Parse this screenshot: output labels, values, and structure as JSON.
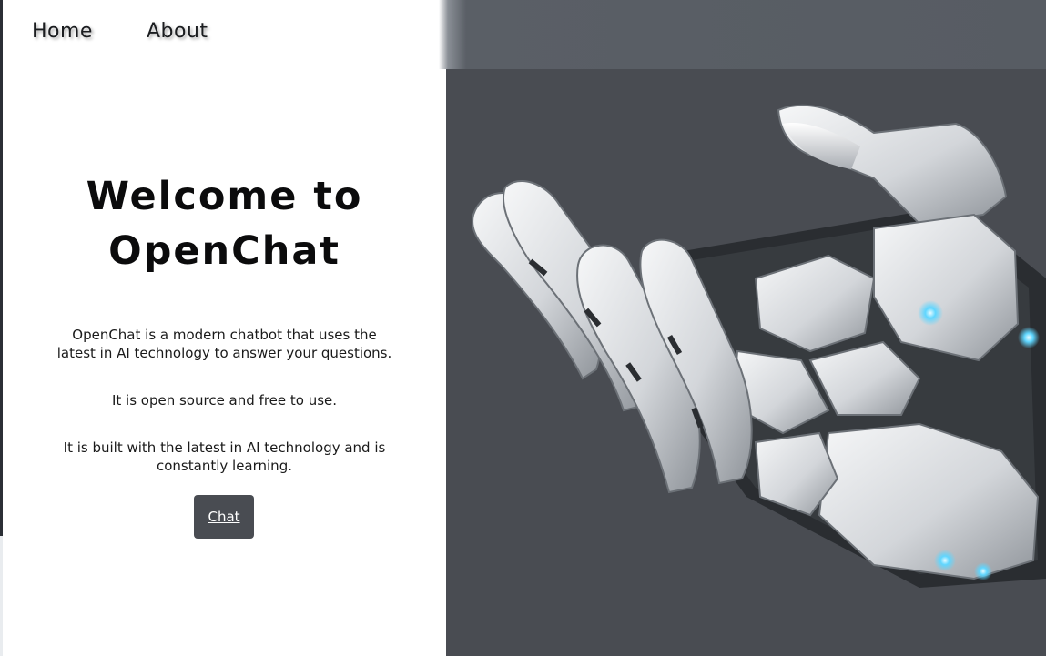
{
  "nav": {
    "home_label": "Home",
    "about_label": "About"
  },
  "hero": {
    "title": "Welcome to OpenChat",
    "paragraphs": [
      "OpenChat is a modern chatbot that uses the latest in AI technology to answer your questions.",
      "It is open source and free to use.",
      "It is built with the latest in AI technology and is constantly learning."
    ],
    "cta_label": "Chat"
  },
  "image": {
    "subject": "robotic-hand-icon"
  },
  "colors": {
    "dark_panel": "#494c52",
    "top_band": "#575c63",
    "button_bg": "#494c52",
    "text": "#0b0b0c"
  }
}
